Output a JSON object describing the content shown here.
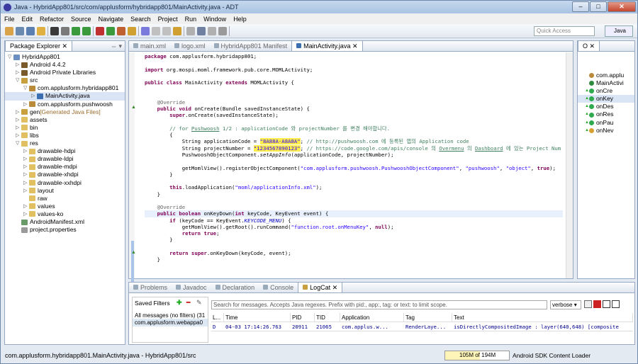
{
  "window": {
    "title": "Java - HybridApp801/src/com/applusform/hybridapp801/MainActivity.java - ADT",
    "min": "–",
    "max": "□",
    "close": "✕"
  },
  "menu": [
    "File",
    "Edit",
    "Refactor",
    "Source",
    "Navigate",
    "Search",
    "Project",
    "Run",
    "Window",
    "Help"
  ],
  "toolbar": {
    "quick_access": "Quick Access",
    "perspective": "Java"
  },
  "package_explorer": {
    "title": "Package Explorer",
    "tab2": "Hierarchy",
    "items": [
      {
        "t": "HybridApp801",
        "lvl": 0,
        "arr": "▽",
        "c": "#6b8fc0"
      },
      {
        "t": "Android 4.4.2",
        "lvl": 1,
        "arr": "▷",
        "c": "#7a5a2a"
      },
      {
        "t": "Android Private Libraries",
        "lvl": 1,
        "arr": "▷",
        "c": "#7a5a2a"
      },
      {
        "t": "src",
        "lvl": 1,
        "arr": "▽",
        "c": "#c8a040"
      },
      {
        "t": "com.applusform.hybridapp801",
        "lvl": 2,
        "arr": "▽",
        "c": "#b88a3a"
      },
      {
        "t": "MainActivity.java",
        "lvl": 3,
        "arr": "▷",
        "c": "#3b6fb0",
        "sel": true
      },
      {
        "t": "com.applusform.pushwoosh",
        "lvl": 2,
        "arr": "▷",
        "c": "#b88a3a"
      },
      {
        "t": "gen",
        "lvl": 1,
        "arr": "▷",
        "c": "#c8a040",
        "extra": " [Generated Java Files]"
      },
      {
        "t": "assets",
        "lvl": 1,
        "arr": "▷",
        "c": "#e0c060"
      },
      {
        "t": "bin",
        "lvl": 1,
        "arr": "▷",
        "c": "#e0c060"
      },
      {
        "t": "libs",
        "lvl": 1,
        "arr": "▷",
        "c": "#e0c060"
      },
      {
        "t": "res",
        "lvl": 1,
        "arr": "▽",
        "c": "#e0c060"
      },
      {
        "t": "drawable-hdpi",
        "lvl": 2,
        "arr": "▷",
        "c": "#e0c060"
      },
      {
        "t": "drawable-ldpi",
        "lvl": 2,
        "arr": "▷",
        "c": "#e0c060"
      },
      {
        "t": "drawable-mdpi",
        "lvl": 2,
        "arr": "▷",
        "c": "#e0c060"
      },
      {
        "t": "drawable-xhdpi",
        "lvl": 2,
        "arr": "▷",
        "c": "#e0c060"
      },
      {
        "t": "drawable-xxhdpi",
        "lvl": 2,
        "arr": "▷",
        "c": "#e0c060"
      },
      {
        "t": "layout",
        "lvl": 2,
        "arr": "▷",
        "c": "#e0c060"
      },
      {
        "t": "raw",
        "lvl": 2,
        "arr": "",
        "c": "#e0c060"
      },
      {
        "t": "values",
        "lvl": 2,
        "arr": "▷",
        "c": "#e0c060"
      },
      {
        "t": "values-ko",
        "lvl": 2,
        "arr": "▷",
        "c": "#e0c060"
      },
      {
        "t": "AndroidManifest.xml",
        "lvl": 1,
        "arr": "",
        "c": "#6a9a6a"
      },
      {
        "t": "project.properties",
        "lvl": 1,
        "arr": "",
        "c": "#9a9a9a"
      }
    ]
  },
  "editor_tabs": [
    {
      "t": "main.xml"
    },
    {
      "t": "logo.xml"
    },
    {
      "t": "HybridApp801 Manifest"
    },
    {
      "t": "MainActivity.java",
      "act": true
    }
  ],
  "code": [
    "package com.applusform.hybridapp801;",
    "",
    "import org.mospi.moml.framework.pub.core.MOMLActivity;",
    "",
    "public class MainActivity extends MOMLActivity {",
    "",
    "",
    "    @Override",
    "    public void onCreate(Bundle savedInstanceState) {",
    "        super.onCreate(savedInstanceState);",
    "",
    "        // for Pushwoosh 1/2 : applicationCode 와 projectNumber 를 변경 해야합니다.",
    "        {",
    "            String applicationCode = \"8A88A-A8A8A\"; // http://pushwoosh.com 에 등록된 앱의 Application code",
    "            String projectNumber = \"1234567890123\"; // https://code.google.com/apis/console 의 Overmenu 의 Dashboard 에 있는 Project Num",
    "            PushwooshObjectComponent.setAppInfo(applicationCode, projectNumber);",
    "",
    "            getMomlView().registerObjectComponent(\"com.applusform.pushwoosh.PushwooshObjectComponent\", \"pushwoosh\", \"object\", true);",
    "        }",
    "",
    "        this.loadApplication(\"moml/applicationInfo.xml\");",
    "    }",
    "",
    "    @Override",
    "    public boolean onKeyDown(int keyCode, KeyEvent event) {",
    "        if (keyCode == KeyEvent.KEYCODE_MENU) {",
    "            getMomlView().getRoot().runCommand(\"function.root.onMenuKey\", null);",
    "            return true;",
    "        }",
    "",
    "        return super.onKeyDown(keyCode, event);",
    "    }"
  ],
  "outline": {
    "title": "O",
    "items": [
      {
        "t": "com.applu",
        "c": "#b88a3a"
      },
      {
        "t": "MainActivi",
        "c": "#2f8a3f"
      },
      {
        "t": "onCre",
        "c": "#2faa4f"
      },
      {
        "t": "onKey",
        "c": "#2faa4f",
        "sel": true
      },
      {
        "t": "onDes",
        "c": "#2faa4f"
      },
      {
        "t": "onRes",
        "c": "#2faa4f"
      },
      {
        "t": "onPau",
        "c": "#2faa4f"
      },
      {
        "t": "onNev",
        "c": "#d8a030"
      }
    ]
  },
  "bottom_tabs": [
    {
      "t": "Problems"
    },
    {
      "t": "Javadoc"
    },
    {
      "t": "Declaration"
    },
    {
      "t": "Console"
    },
    {
      "t": "LogCat",
      "act": true
    }
  ],
  "logcat": {
    "saved_filters": "Saved Filters",
    "filters": [
      "All messages (no filters) (31",
      "com.applusform.webappa0"
    ],
    "search_placeholder": "Search for messages. Accepts Java regexes. Prefix with pid:, app:, tag: or text: to limit scope.",
    "level": "verbose",
    "columns": [
      "L...",
      "Time",
      "PID",
      "TID",
      "Application",
      "Tag",
      "Text"
    ],
    "rows": [
      [
        "D",
        "04-03 17:14:26.763",
        "20911",
        "21065",
        "com.applus.w...",
        "RenderLaye...",
        "isDirectlyCompositedImage : layer(640,648) [composite"
      ]
    ]
  },
  "status": {
    "path": "com.applusform.hybridapp801.MainActivity.java - HybridApp801/src",
    "memory": "105M of 194M",
    "memory_fraction": 0.54,
    "loader": "Android SDK Content Loader"
  }
}
